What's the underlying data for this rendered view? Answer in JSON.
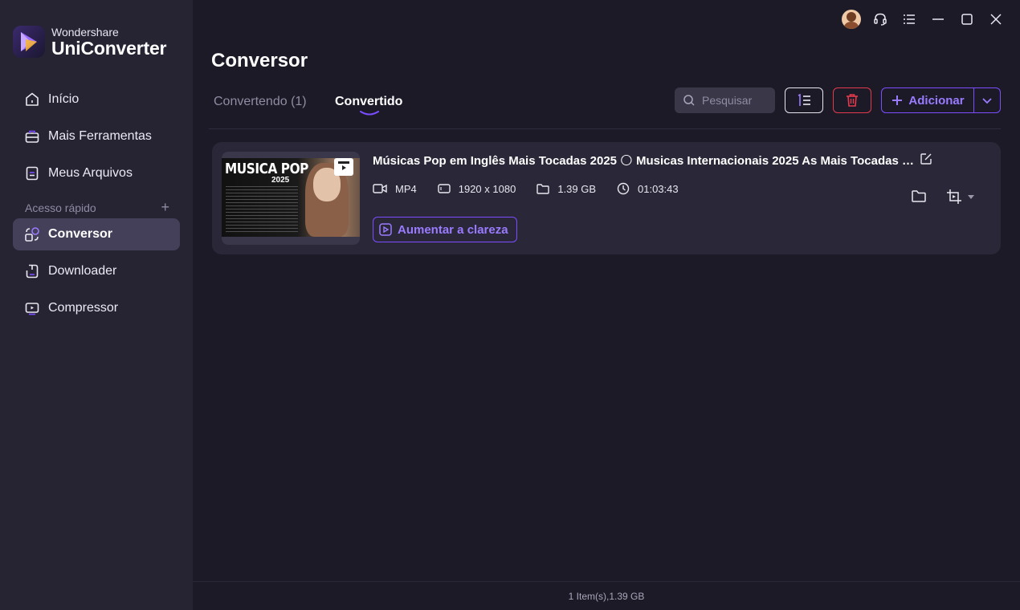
{
  "app": {
    "brand_sub": "Wondershare",
    "brand_main": "UniConverter"
  },
  "sidebar": {
    "items": [
      {
        "label": "Início",
        "icon": "home-icon"
      },
      {
        "label": "Mais Ferramentas",
        "icon": "toolbox-icon"
      },
      {
        "label": "Meus Arquivos",
        "icon": "files-icon"
      }
    ],
    "quick_access_label": "Acesso rápido",
    "quick_items": [
      {
        "label": "Conversor",
        "icon": "converter-icon",
        "active": true
      },
      {
        "label": "Downloader",
        "icon": "downloader-icon"
      },
      {
        "label": "Compressor",
        "icon": "compressor-icon"
      }
    ]
  },
  "main": {
    "title": "Conversor",
    "tabs": [
      {
        "label": "Convertendo (1)",
        "active": false
      },
      {
        "label": "Convertido",
        "active": true
      }
    ],
    "search_placeholder": "Pesquisar",
    "add_label": "Adicionar"
  },
  "file": {
    "name": "Músicas Pop em Inglês Mais Tocadas 2025 🌕 Musicas Internacionais 2025 As Mais Tocadas Nas Rádios",
    "format": "MP4",
    "resolution": "1920 x 1080",
    "size": "1.39 GB",
    "duration": "01:03:43",
    "thumb_title": "MUSICA POP",
    "thumb_year": "2025",
    "action_label": "Aumentar a clareza"
  },
  "status": {
    "summary": "1 Item(s),1.39 GB"
  },
  "colors": {
    "accent": "#7b4dff",
    "danger": "#e23b4d",
    "sidebar_bg": "#262433",
    "main_bg": "#1c1a27"
  }
}
